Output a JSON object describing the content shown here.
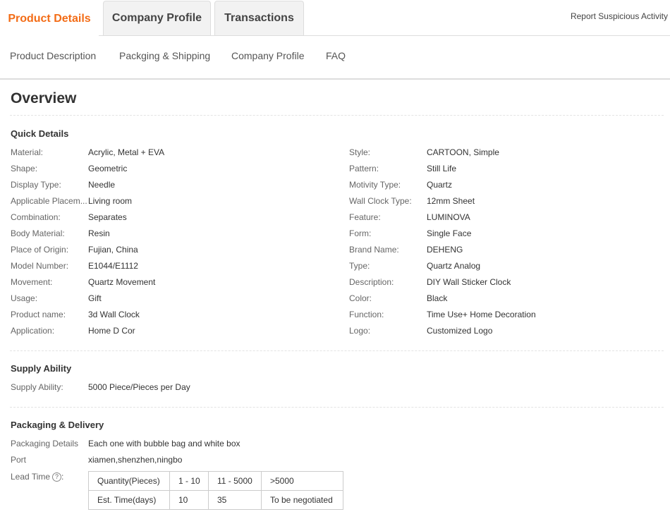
{
  "tabs": [
    {
      "label": "Product Details"
    },
    {
      "label": "Company Profile"
    },
    {
      "label": "Transactions"
    }
  ],
  "report_link": "Report Suspicious Activity",
  "subnav": [
    {
      "label": "Product Description"
    },
    {
      "label": "Packging & Shipping"
    },
    {
      "label": "Company Profile"
    },
    {
      "label": "FAQ"
    }
  ],
  "overview_title": "Overview",
  "quick_details": {
    "title": "Quick Details",
    "left": [
      {
        "label": "Material:",
        "value": "Acrylic, Metal + EVA"
      },
      {
        "label": "Shape:",
        "value": "Geometric"
      },
      {
        "label": "Display Type:",
        "value": "Needle"
      },
      {
        "label": "Applicable Placem...",
        "value": "Living room"
      },
      {
        "label": "Combination:",
        "value": "Separates"
      },
      {
        "label": "Body Material:",
        "value": "Resin"
      },
      {
        "label": "Place of Origin:",
        "value": "Fujian, China"
      },
      {
        "label": "Model Number:",
        "value": "E1044/E1112"
      },
      {
        "label": "Movement:",
        "value": "Quartz Movement"
      },
      {
        "label": "Usage:",
        "value": "Gift"
      },
      {
        "label": "Product name:",
        "value": "3d Wall Clock"
      },
      {
        "label": "Application:",
        "value": "Home D Cor"
      }
    ],
    "right": [
      {
        "label": "Style:",
        "value": "CARTOON, Simple"
      },
      {
        "label": "Pattern:",
        "value": "Still Life"
      },
      {
        "label": "Motivity Type:",
        "value": "Quartz"
      },
      {
        "label": "Wall Clock Type:",
        "value": "12mm Sheet"
      },
      {
        "label": "Feature:",
        "value": "LUMINOVA"
      },
      {
        "label": "Form:",
        "value": "Single Face"
      },
      {
        "label": "Brand Name:",
        "value": "DEHENG"
      },
      {
        "label": "Type:",
        "value": "Quartz Analog"
      },
      {
        "label": "Description:",
        "value": "DIY Wall Sticker Clock"
      },
      {
        "label": "Color:",
        "value": "Black"
      },
      {
        "label": "Function:",
        "value": "Time Use+ Home Decoration"
      },
      {
        "label": "Logo:",
        "value": "Customized Logo"
      }
    ]
  },
  "supply_ability": {
    "title": "Supply Ability",
    "label": "Supply Ability:",
    "value": "5000 Piece/Pieces per Day"
  },
  "packaging": {
    "title": "Packaging & Delivery",
    "details_label": "Packaging Details",
    "details_value": "Each one with bubble bag and white box",
    "port_label": "Port",
    "port_value": "xiamen,shenzhen,ningbo",
    "lead_time_label": "Lead Time",
    "help_icon": "?",
    "help_colon": ":",
    "lead_table": {
      "header": [
        "Quantity(Pieces)",
        "1 - 10",
        "11 - 5000",
        ">5000"
      ],
      "row": [
        "Est. Time(days)",
        "10",
        "35",
        "To be negotiated"
      ]
    }
  },
  "colors": {
    "accent": "#f36c16"
  }
}
